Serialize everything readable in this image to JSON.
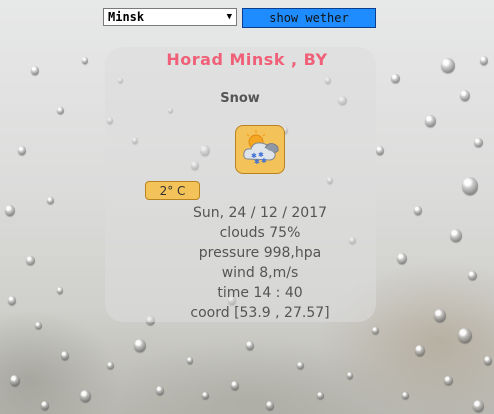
{
  "city_select": {
    "value": "Minsk"
  },
  "show_button": {
    "label": "show wether"
  },
  "weather": {
    "title": "Horad Minsk , BY",
    "condition": "Snow",
    "icon": "snow-cloud-sun-icon",
    "temperature": "2° C",
    "date": "Sun, 24 / 12 / 2017",
    "clouds": "clouds 75%",
    "pressure": "pressure 998,hpa",
    "wind": "wind 8,m/s",
    "time": "time 14 : 40",
    "coord": "coord [53.9 , 27.57]"
  },
  "colors": {
    "title": "#f06078",
    "button": "#1e8cff",
    "badge": "#f3c259",
    "text": "#555555"
  }
}
